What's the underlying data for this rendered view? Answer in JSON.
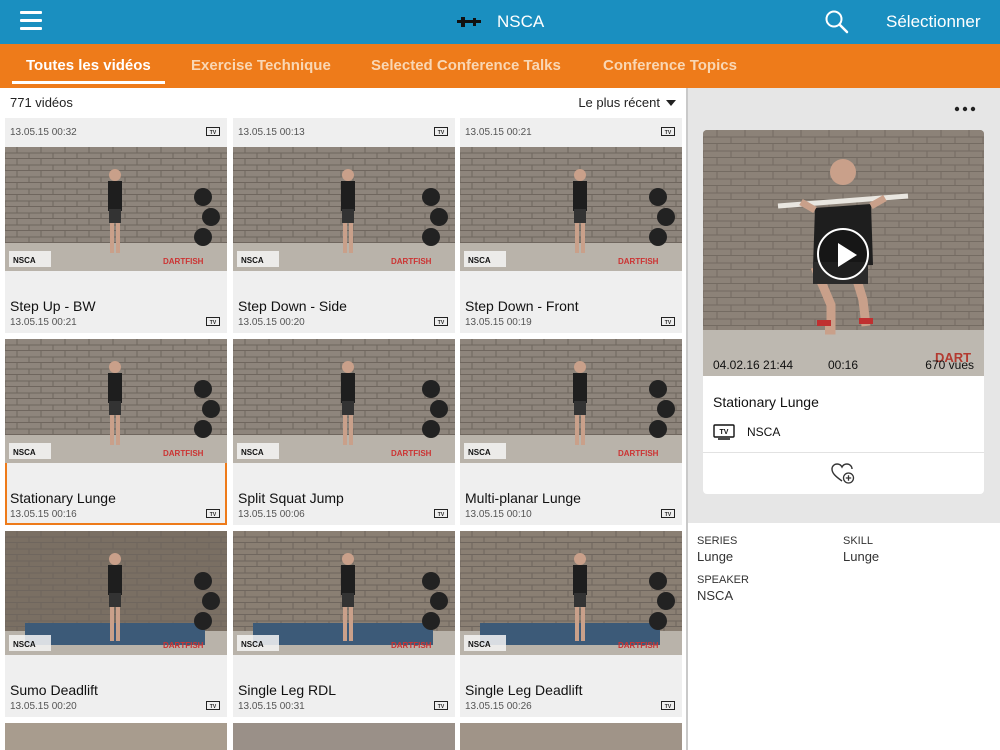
{
  "app": {
    "title": "NSCA",
    "select_label": "Sélectionner"
  },
  "tabs": [
    {
      "label": "Toutes les vidéos",
      "active": true
    },
    {
      "label": "Exercise Technique",
      "active": false
    },
    {
      "label": "Selected Conference Talks",
      "active": false
    },
    {
      "label": "Conference Topics",
      "active": false
    }
  ],
  "list": {
    "count": "771 vidéos",
    "sort": "Le plus récent",
    "partial_row": [
      {
        "date": "13.05.15 00:32"
      },
      {
        "date": "13.05.15 00:13"
      },
      {
        "date": "13.05.15 00:21"
      }
    ],
    "videos": [
      {
        "title": "Step Up - BW",
        "date": "13.05.15 00:21"
      },
      {
        "title": "Step Down - Side",
        "date": "13.05.15 00:20"
      },
      {
        "title": "Step Down - Front",
        "date": "13.05.15 00:19"
      },
      {
        "title": "Stationary Lunge",
        "date": "13.05.15 00:16",
        "selected": true
      },
      {
        "title": "Split Squat Jump",
        "date": "13.05.15 00:06"
      },
      {
        "title": "Multi-planar Lunge",
        "date": "13.05.15 00:10"
      },
      {
        "title": "Sumo Deadlift",
        "date": "13.05.15 00:20"
      },
      {
        "title": "Single Leg RDL",
        "date": "13.05.15 00:31"
      },
      {
        "title": "Single Leg Deadlift",
        "date": "13.05.15 00:26"
      }
    ],
    "watermark": "DARTFISH",
    "thumb_logo": "NSCA"
  },
  "detail": {
    "date": "04.02.16 21:44",
    "duration": "00:16",
    "views": "670 vues",
    "title": "Stationary Lunge",
    "channel": "NSCA",
    "watermark": "DART",
    "series_label": "SERIES",
    "series_value": "Lunge",
    "skill_label": "SKILL",
    "skill_value": "Lunge",
    "speaker_label": "SPEAKER",
    "speaker_value": "NSCA"
  },
  "colors": {
    "topbar": "#1a8fc0",
    "tabbar": "#ee7b1a",
    "selected_outline": "#ee7b1a"
  }
}
